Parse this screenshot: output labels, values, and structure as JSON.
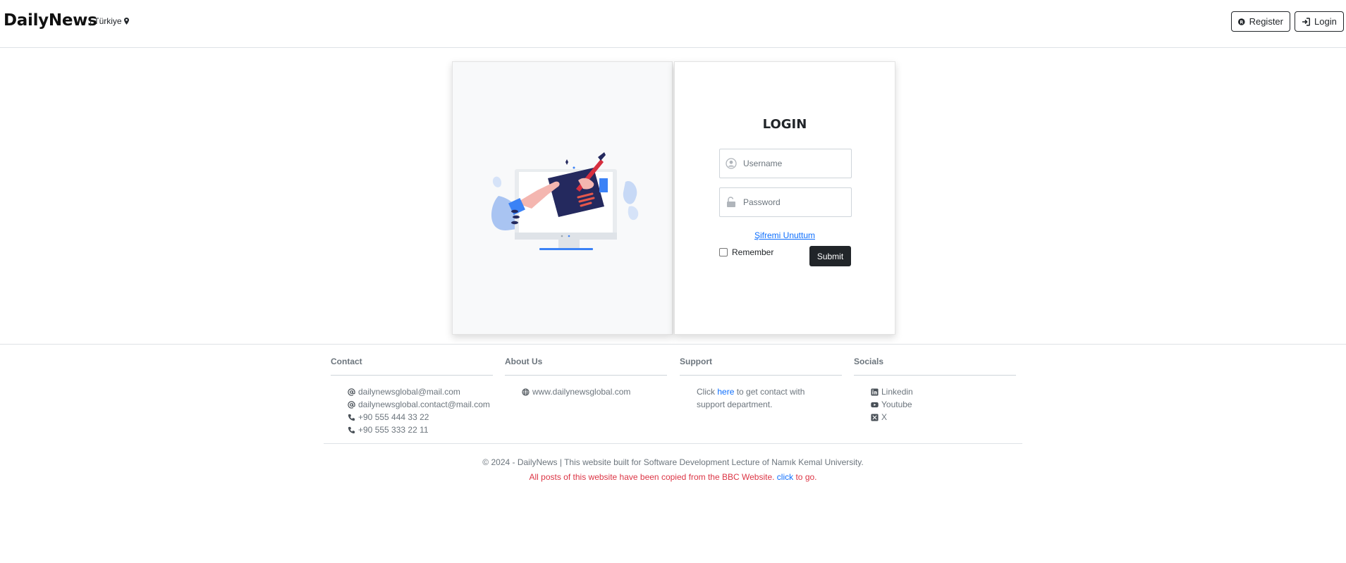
{
  "header": {
    "brand": "DailyNews",
    "region": "| Türkiye",
    "register_label": "Register",
    "login_label": "Login"
  },
  "login": {
    "title": "LOGIN",
    "username_placeholder": "Username",
    "password_placeholder": "Password",
    "forgot_label": "Şifremi Unuttum",
    "remember_label": "Remember",
    "submit_label": "Submit"
  },
  "footer": {
    "contact": {
      "title": "Contact",
      "items": [
        {
          "icon": "at-icon",
          "text": "dailynewsglobal@mail.com"
        },
        {
          "icon": "at-icon",
          "text": "dailynewsglobal.contact@mail.com"
        },
        {
          "icon": "phone-icon",
          "text": "+90 555 444 33 22"
        },
        {
          "icon": "phone-icon",
          "text": "+90 555 333 22 11"
        }
      ]
    },
    "about": {
      "title": "About Us",
      "items": [
        {
          "icon": "globe-icon",
          "text": "www.dailynewsglobal.com"
        }
      ]
    },
    "support": {
      "title": "Support",
      "text_before": "Click ",
      "link": "here",
      "text_after": " to get contact with support department."
    },
    "socials": {
      "title": "Socials",
      "items": [
        {
          "icon": "linkedin-icon",
          "text": "Linkedin"
        },
        {
          "icon": "youtube-icon",
          "text": "Youtube"
        },
        {
          "icon": "x-icon",
          "text": "X"
        }
      ]
    },
    "copyright": "© 2024 - DailyNews | This website built for Software Development Lecture of Namık Kemal University.",
    "disclaimer_before": "All posts of this website have been copied from the BBC Website. ",
    "disclaimer_link": "click",
    "disclaimer_after": " to go."
  },
  "colors": {
    "dark": "#212529",
    "muted": "#6c757d",
    "link": "#0d6efd",
    "danger": "#dc3545"
  }
}
